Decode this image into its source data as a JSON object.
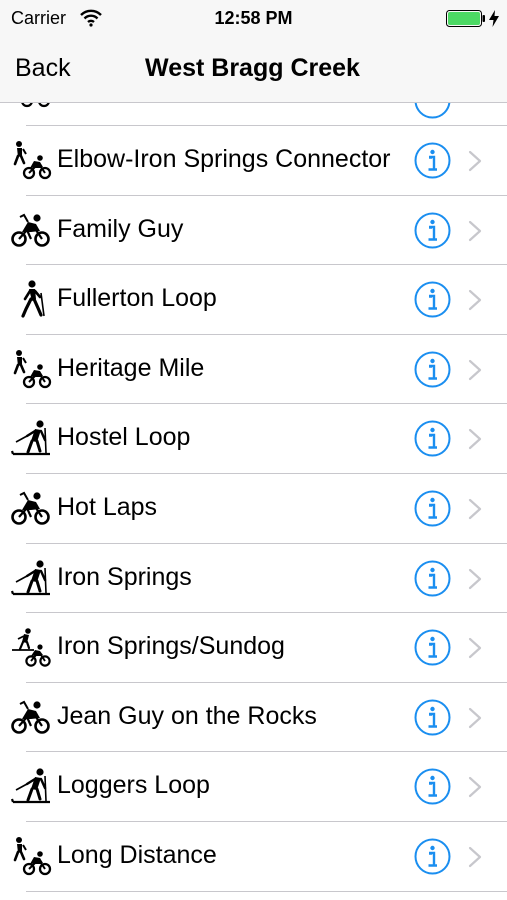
{
  "status_bar": {
    "carrier": "Carrier",
    "time": "12:58 PM",
    "wifi_icon": "wifi-icon",
    "battery_icon": "battery-icon",
    "battery_color": "#4cd964"
  },
  "nav": {
    "back_label": "Back",
    "title": "West Bragg Creek"
  },
  "accent_color": "#1a8ef0",
  "trails": [
    {
      "name": "Elbow-Iron Springs Connector",
      "icon": "hike-bike-icon"
    },
    {
      "name": "Family Guy",
      "icon": "bike-icon"
    },
    {
      "name": "Fullerton Loop",
      "icon": "hike-icon"
    },
    {
      "name": "Heritage Mile",
      "icon": "hike-bike-icon"
    },
    {
      "name": "Hostel Loop",
      "icon": "ski-icon"
    },
    {
      "name": "Hot Laps",
      "icon": "bike-icon"
    },
    {
      "name": "Iron Springs",
      "icon": "ski-icon"
    },
    {
      "name": "Iron Springs/Sundog",
      "icon": "ski-bike-icon"
    },
    {
      "name": "Jean Guy on the Rocks",
      "icon": "bike-icon"
    },
    {
      "name": "Loggers Loop",
      "icon": "ski-icon"
    },
    {
      "name": "Long Distance",
      "icon": "hike-bike-icon"
    }
  ]
}
